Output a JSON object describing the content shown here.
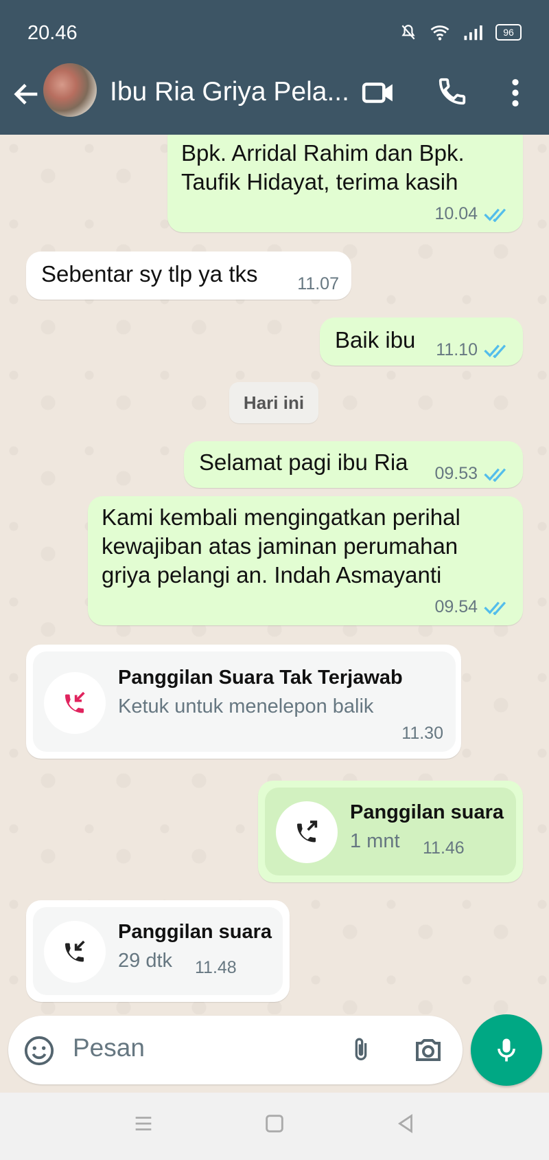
{
  "status": {
    "time": "20.46",
    "battery": "96"
  },
  "header": {
    "contact_name": "Ibu Ria Griya Pela..."
  },
  "messages": [
    {
      "text_line1": "Bpk. Arridal Rahim dan Bpk.",
      "text_line2": "Taufik Hidayat, terima kasih",
      "time": "10.04"
    },
    {
      "text": "Sebentar sy tlp ya tks",
      "time": "11.07"
    },
    {
      "text": "Baik ibu",
      "time": "11.10"
    },
    {
      "text": "Selamat pagi ibu Ria",
      "time": "09.53"
    },
    {
      "line1": "Kami kembali mengingatkan perihal",
      "line2": "kewajiban atas jaminan perumahan",
      "line3": "griya pelangi an. Indah Asmayanti",
      "time": "09.54"
    }
  ],
  "date_divider": "Hari ini",
  "calls": [
    {
      "title": "Panggilan Suara Tak Terjawab",
      "subtitle": "Ketuk untuk menelepon balik",
      "time": "11.30"
    },
    {
      "title": "Panggilan suara",
      "subtitle": "1 mnt",
      "time": "11.46"
    },
    {
      "title": "Panggilan suara",
      "subtitle": "29 dtk",
      "time": "11.48"
    }
  ],
  "composer": {
    "placeholder": "Pesan"
  },
  "colors": {
    "header": "#3d5565",
    "outgoing": "#e2fdd2",
    "accent": "#00a884",
    "ticks": "#53bdeb",
    "missed": "#e0245e"
  },
  "icons": [
    "back-arrow-icon",
    "video-call-icon",
    "phone-icon",
    "more-icon",
    "emoji-icon",
    "attach-icon",
    "camera-icon",
    "mic-icon",
    "missed-call-icon",
    "outgoing-call-icon",
    "incoming-call-icon"
  ]
}
